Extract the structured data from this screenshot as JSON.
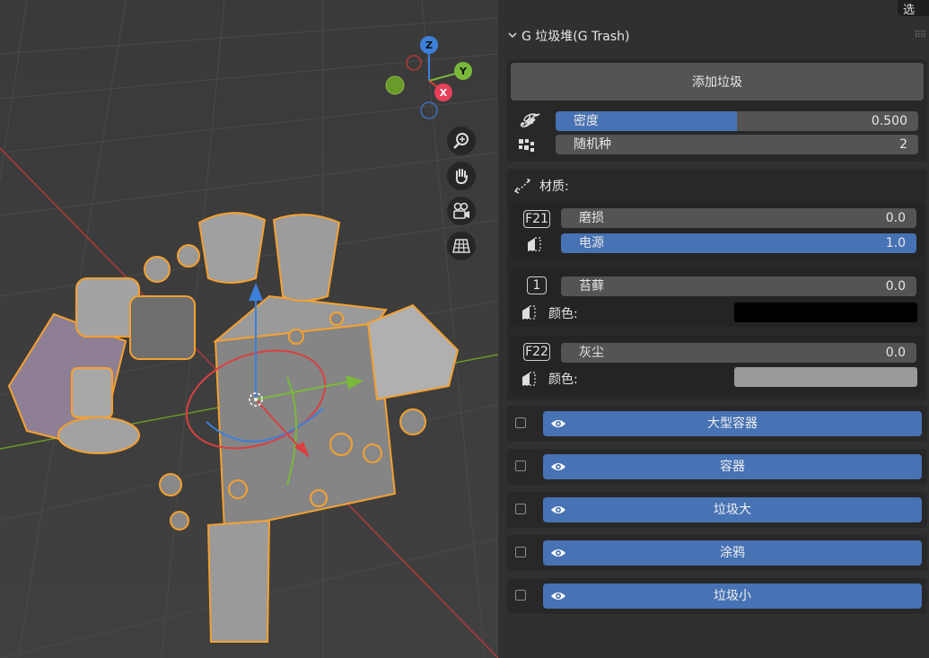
{
  "top_tab": {
    "label": "选"
  },
  "panel": {
    "title": "G 垃圾堆(G Trash)",
    "add_button_label": "添加垃圾",
    "density": {
      "label": "密度",
      "value": "0.500",
      "fraction": 0.5
    },
    "seed": {
      "label": "随机种",
      "value": "2"
    },
    "materials": {
      "label": "材质:",
      "wear": {
        "icon_text": "F21",
        "label": "磨损",
        "value": "0.0"
      },
      "power": {
        "label": "电源",
        "value": "1.0",
        "fraction": 1.0
      },
      "moss": {
        "icon_text": "1",
        "label": "苔藓",
        "value": "0.0",
        "color_label": "颜色:",
        "color": "#000000"
      },
      "dust": {
        "icon_text": "F22",
        "label": "灰尘",
        "value": "0.0",
        "color_label": "颜色:",
        "color": "#9a9a9a"
      }
    },
    "collections": [
      {
        "label": "大型容器"
      },
      {
        "label": "容器"
      },
      {
        "label": "垃圾大"
      },
      {
        "label": "涂鸦"
      },
      {
        "label": "垃圾小"
      }
    ]
  },
  "gizmo": {
    "z": "Z",
    "y": "Y",
    "x": "X"
  },
  "colors": {
    "accent": "#4772b3",
    "selection": "#f5a030"
  }
}
